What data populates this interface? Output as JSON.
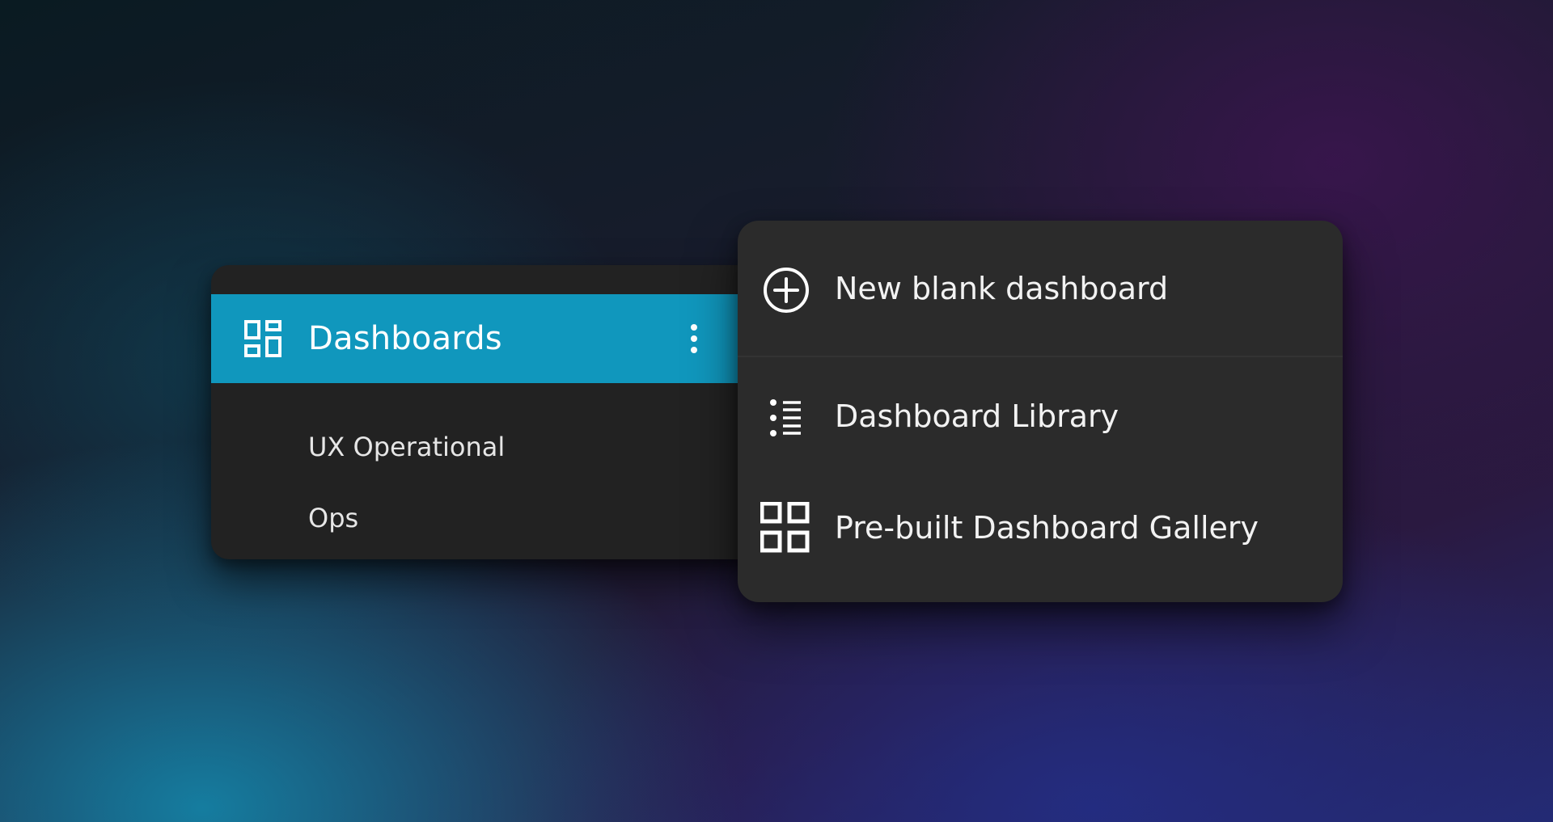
{
  "nav": {
    "header": {
      "label": "Dashboards",
      "icon": "dashboard-icon",
      "more_icon": "more-vertical-icon"
    },
    "items": [
      {
        "label": "UX Operational"
      },
      {
        "label": "Ops"
      }
    ]
  },
  "menu": {
    "items": [
      {
        "label": "New blank dashboard",
        "icon": "add-circle-icon"
      },
      {
        "label": "Dashboard Library",
        "icon": "list-icon"
      },
      {
        "label": "Pre-built Dashboard Gallery",
        "icon": "grid-icon"
      }
    ]
  },
  "colors": {
    "accent": "#1097bd",
    "panel": "#222222",
    "menu": "#2b2b2b",
    "text": "#ffffff"
  }
}
